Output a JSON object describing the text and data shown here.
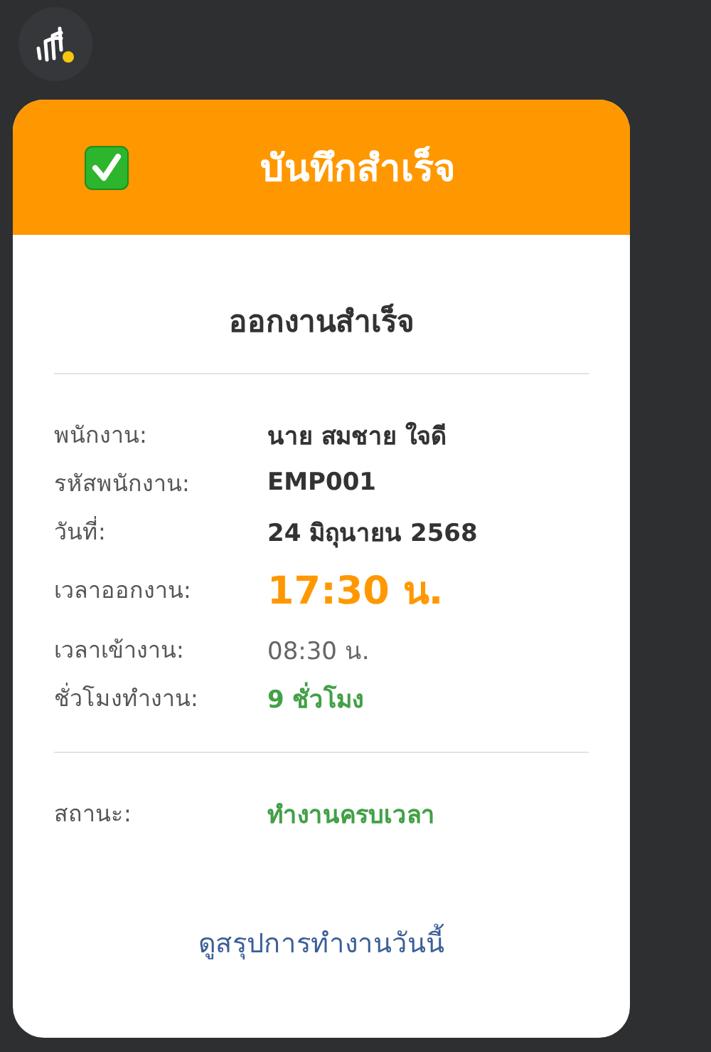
{
  "header": {
    "title": "บันทึกสำเร็จ"
  },
  "card": {
    "heading": "ออกงานสำเร็จ",
    "details": [
      {
        "label": "พนักงาน:",
        "value": "นาย สมชาย ใจดี",
        "kind": "bold"
      },
      {
        "label": "รหัสพนักงาน:",
        "value": "EMP001",
        "kind": "bold"
      },
      {
        "label": "วันที่:",
        "value": "24 มิถุนายน 2568",
        "kind": "bold"
      },
      {
        "label": "เวลาออกงาน:",
        "value": "17:30 น.",
        "kind": "highlight"
      },
      {
        "label": "เวลาเข้างาน:",
        "value": "08:30 น.",
        "kind": "muted"
      },
      {
        "label": "ชั่วโมงทำงาน:",
        "value": "9 ชั่วโมง",
        "kind": "success"
      }
    ],
    "status": {
      "label": "สถานะ:",
      "value": "ทำงานครบเวลา",
      "kind": "success"
    },
    "link": "ดูสรุปการทำงานวันนี้"
  }
}
